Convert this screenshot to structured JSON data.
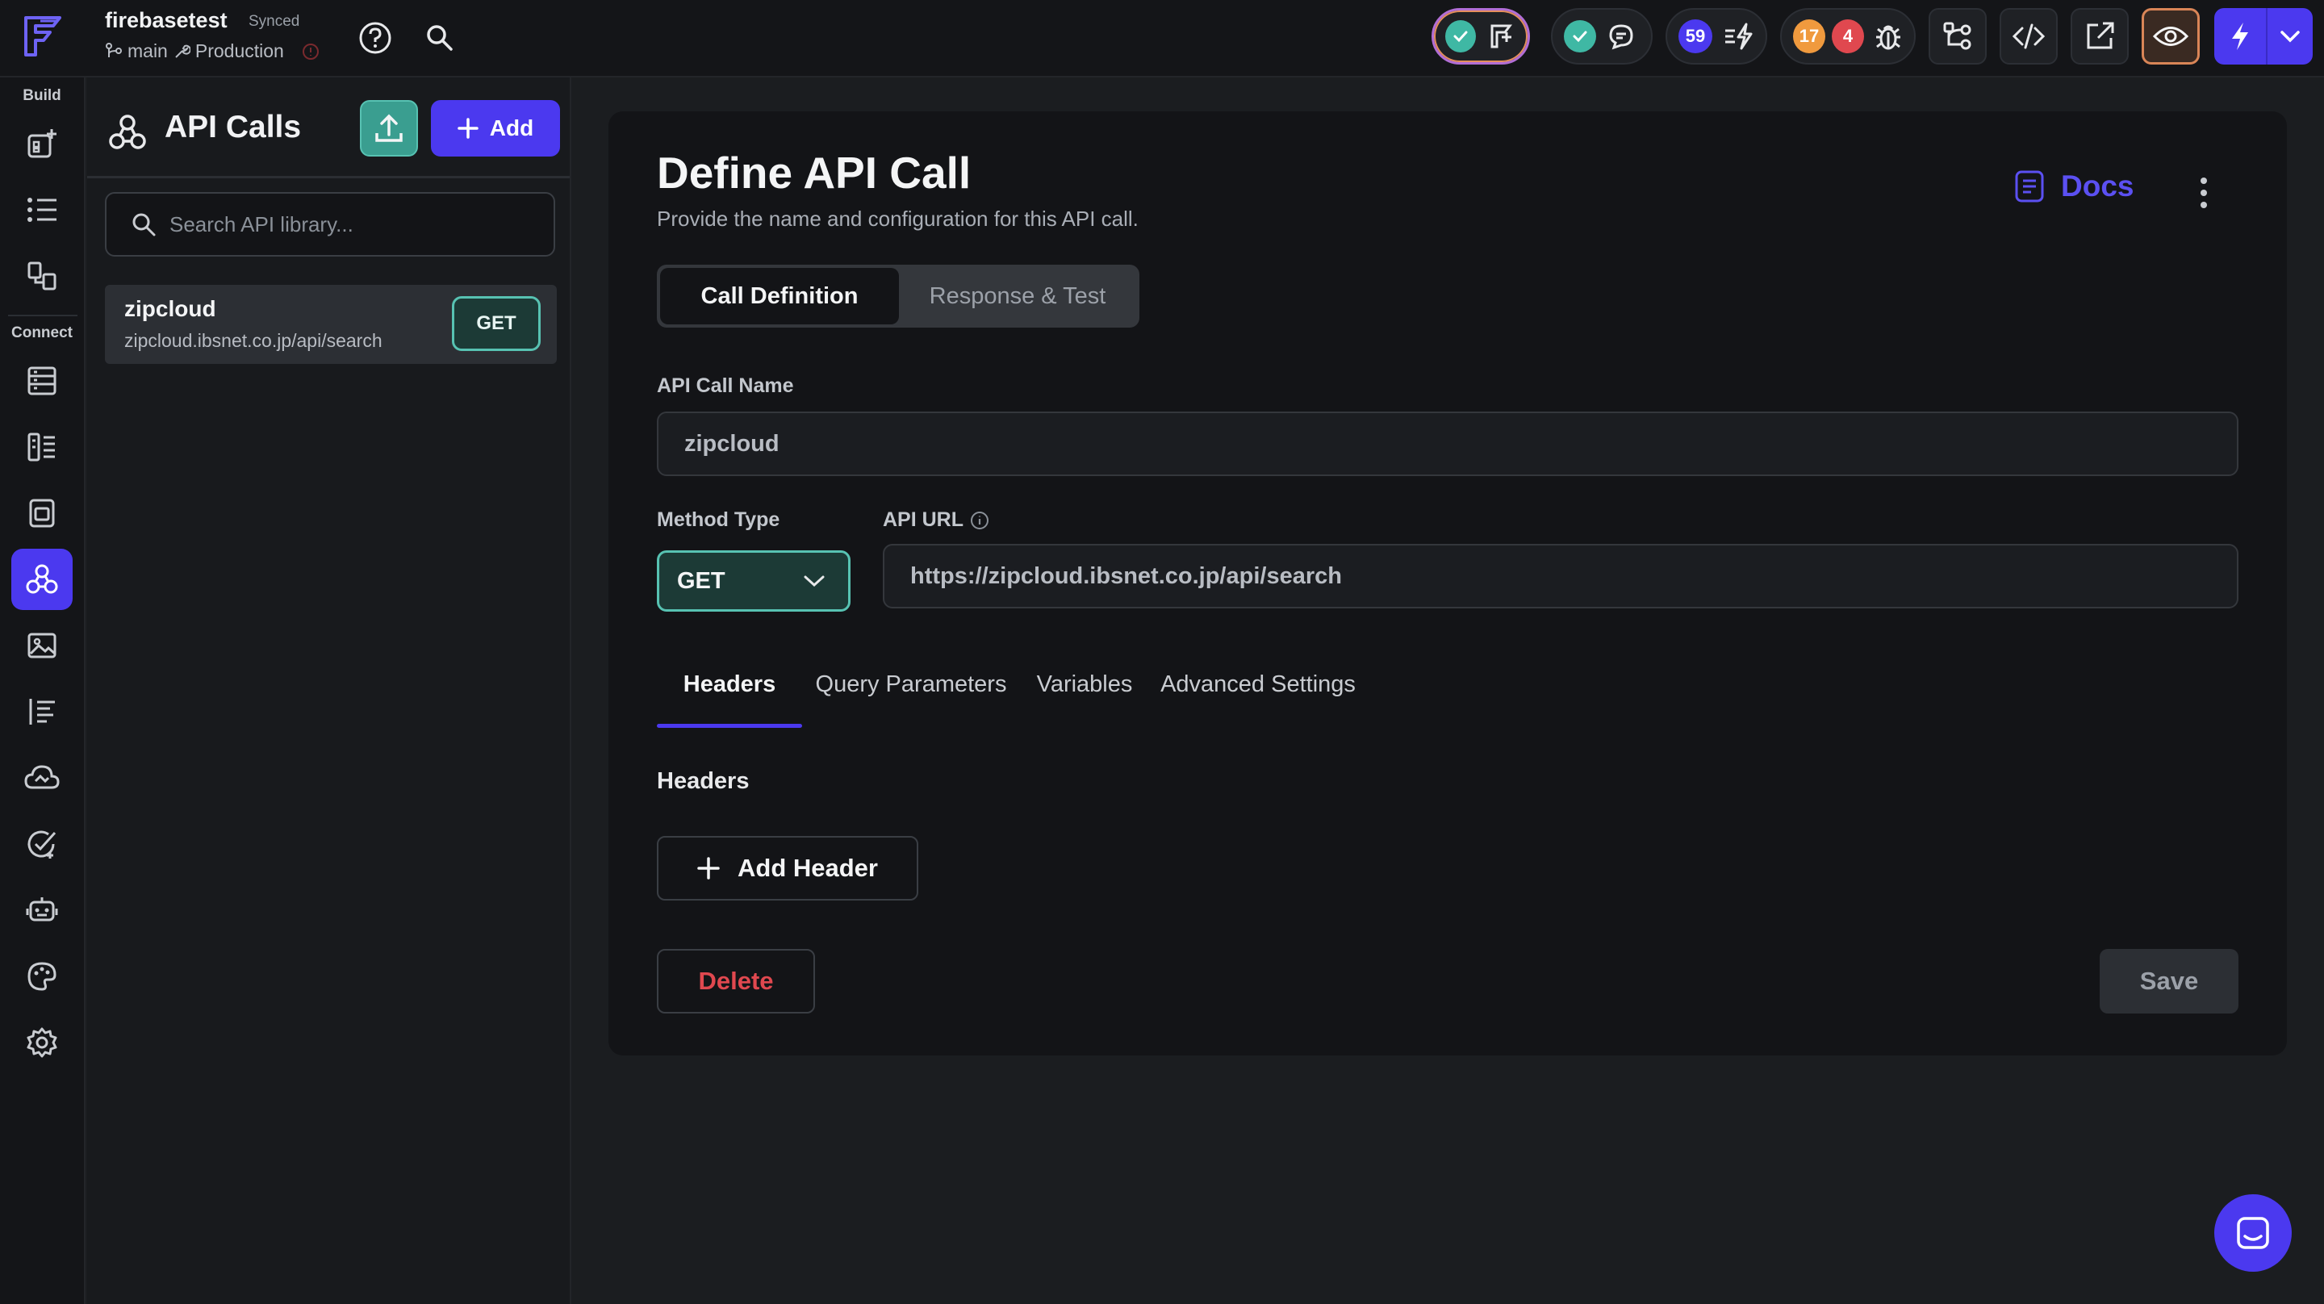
{
  "project": {
    "name": "firebasetest",
    "sync_status": "Synced",
    "branch": "main",
    "environment": "Production"
  },
  "topbar": {
    "help_icon": "help-circle-icon",
    "search_icon": "search-icon",
    "badges": {
      "warnings_count": "59",
      "errors_primary_count": "17",
      "errors_secondary_count": "4"
    },
    "colors": {
      "accent": "#4b39ef",
      "teal": "#3fb8a4",
      "orange": "#f09a3e",
      "red": "#e0484f"
    }
  },
  "rail": {
    "build_label": "Build",
    "connect_label": "Connect",
    "items": [
      {
        "icon": "add-widget-icon"
      },
      {
        "icon": "list-icon"
      },
      {
        "icon": "storyboard-icon"
      },
      {
        "icon": "firestore-icon"
      },
      {
        "icon": "data-types-icon"
      },
      {
        "icon": "app-state-icon"
      },
      {
        "icon": "api-calls-icon",
        "active": true
      },
      {
        "icon": "media-assets-icon"
      },
      {
        "icon": "custom-code-icon"
      },
      {
        "icon": "cloud-functions-icon"
      },
      {
        "icon": "tests-icon"
      },
      {
        "icon": "agents-icon"
      },
      {
        "icon": "theme-icon"
      },
      {
        "icon": "settings-icon"
      }
    ]
  },
  "api_panel": {
    "title": "API Calls",
    "add_label": "Add",
    "search_placeholder": "Search API library...",
    "items": [
      {
        "name": "zipcloud",
        "url": "zipcloud.ibsnet.co.jp/api/search",
        "method": "GET"
      }
    ]
  },
  "main": {
    "title": "Define API Call",
    "subtitle": "Provide the name and configuration for this API call.",
    "docs_label": "Docs",
    "segments": [
      "Call Definition",
      "Response & Test"
    ],
    "api_call_name_label": "API Call Name",
    "api_call_name_value": "zipcloud",
    "method_type_label": "Method Type",
    "method_type_value": "GET",
    "api_url_label": "API URL",
    "api_url_value": "https://zipcloud.ibsnet.co.jp/api/search",
    "tabs": [
      "Headers",
      "Query Parameters",
      "Variables",
      "Advanced Settings"
    ],
    "section_title": "Headers",
    "add_header_label": "Add Header",
    "delete_label": "Delete",
    "save_label": "Save"
  }
}
